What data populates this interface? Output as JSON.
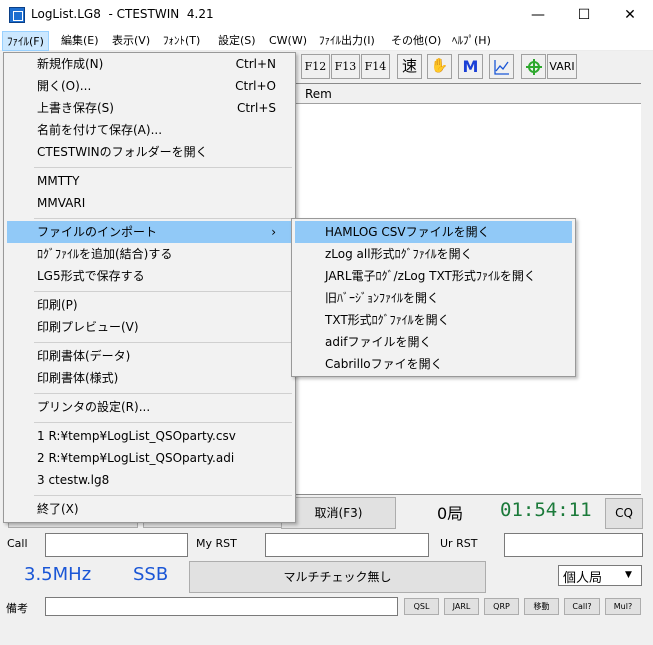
{
  "window": {
    "title": "LogList.LG8  - CTESTWIN  4.21",
    "minimize_glyph": "—",
    "maximize_glyph": "☐",
    "close_glyph": "✕"
  },
  "menubar": [
    "ﾌｧｲﾙ(F)",
    "編集(E)",
    "表示(V)",
    "ﾌｫﾝﾄ(T)",
    "設定(S)",
    "CW(W)",
    "ﾌｧｲﾙ出力(I)",
    "その他(O)",
    "ﾍﾙﾌﾟ(H)"
  ],
  "toolbar": {
    "f12": "F12",
    "f13": "F13",
    "f14": "F14",
    "speed": "速",
    "hand": "✋",
    "m": "M",
    "chart": "📈",
    "plus": "✚",
    "vari": "VARI"
  },
  "grid": {
    "rem_header": "Rem"
  },
  "file_menu": {
    "items": [
      {
        "label": "新規作成(N)",
        "shortcut": "Ctrl+N"
      },
      {
        "label": "開く(O)...",
        "shortcut": "Ctrl+O"
      },
      {
        "label": "上書き保存(S)",
        "shortcut": "Ctrl+S"
      },
      {
        "label": "名前を付けて保存(A)...",
        "shortcut": ""
      },
      {
        "label": "CTESTWINのフォルダーを開く",
        "shortcut": ""
      },
      {
        "label": "MMTTY",
        "shortcut": ""
      },
      {
        "label": "MMVARI",
        "shortcut": ""
      },
      {
        "label": "ファイルのインポート",
        "shortcut": "›"
      },
      {
        "label": "ﾛｸﾞﾌｧｲﾙを追加(結合)する",
        "shortcut": ""
      },
      {
        "label": "LG5形式で保存する",
        "shortcut": ""
      },
      {
        "label": "印刷(P)",
        "shortcut": ""
      },
      {
        "label": "印刷プレビュー(V)",
        "shortcut": ""
      },
      {
        "label": "印刷書体(データ)",
        "shortcut": ""
      },
      {
        "label": "印刷書体(様式)",
        "shortcut": ""
      },
      {
        "label": "プリンタの設定(R)...",
        "shortcut": ""
      },
      {
        "label": "1 R:¥temp¥LogList_QSOparty.csv",
        "shortcut": ""
      },
      {
        "label": "2 R:¥temp¥LogList_QSOparty.adi",
        "shortcut": ""
      },
      {
        "label": "3 ctestw.lg8",
        "shortcut": ""
      },
      {
        "label": "終了(X)",
        "shortcut": ""
      }
    ]
  },
  "import_submenu": {
    "items": [
      "HAMLOG CSVファイルを開く",
      "zLog all形式ﾛｸﾞﾌｧｲﾙを開く",
      "JARL電子ﾛｸﾞ/zLog TXT形式ﾌｧｲﾙを開く",
      "旧ﾊﾞｰｼﾞｮﾝﾌｧｲﾙを開く",
      "TXT形式ﾛｸﾞﾌｧｲﾙを開く",
      "adifファイルを開く",
      "Cabrilloファイを開く"
    ]
  },
  "panel": {
    "cancel_button": "取消(F3)",
    "qso_count": "0局",
    "clock": "01:54:11",
    "cq_button": "CQ",
    "call_label": "Call",
    "my_rst_label": "My RST",
    "ur_rst_label": "Ur RST",
    "freq": "3.5MHz",
    "mode": "SSB",
    "multi_check_button": "マルチチェック無し",
    "station_type": "個人局",
    "remarks_label": "備考",
    "small_buttons": [
      "QSL",
      "JARL",
      "QRP",
      "移動",
      "Call?",
      "Mul?"
    ]
  },
  "colors": {
    "accent_blue": "#1a56d6",
    "clock_green": "#1b7a3a",
    "menu_highlight": "#91c9f7"
  }
}
